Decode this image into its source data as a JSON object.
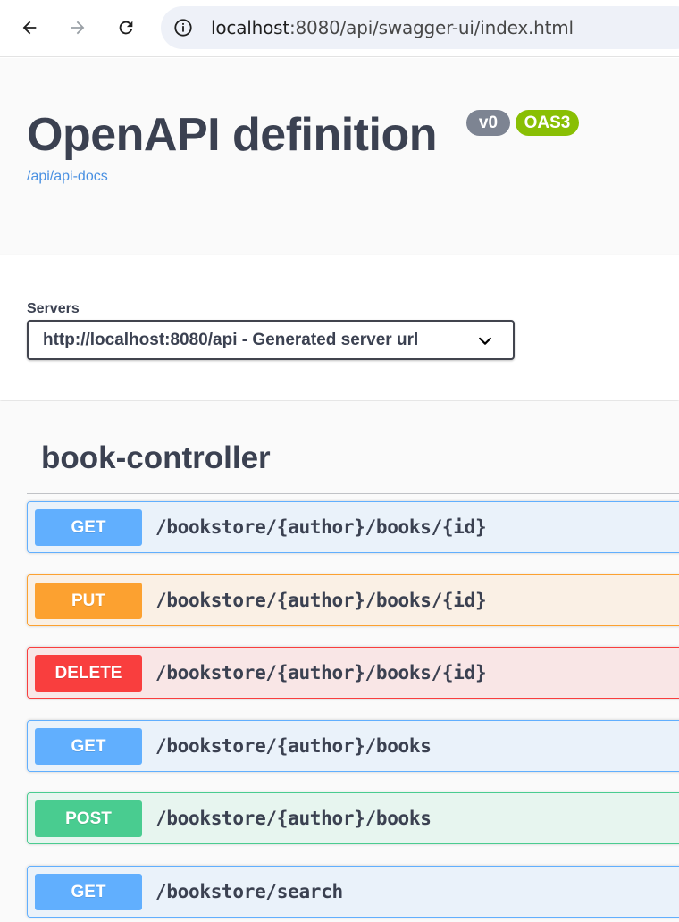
{
  "browser": {
    "url_host": "localhost",
    "url_rest": ":8080/api/swagger-ui/index.html",
    "icons": [
      "back-arrow-icon",
      "forward-arrow-icon",
      "reload-icon",
      "info-icon"
    ]
  },
  "info": {
    "title": "OpenAPI definition",
    "version_badge": "v0",
    "oas_badge": "OAS3",
    "docs_link": "/api/api-docs"
  },
  "servers": {
    "label": "Servers",
    "selected": "http://localhost:8080/api - Generated server url"
  },
  "tag": {
    "name": "book-controller"
  },
  "operations": [
    {
      "method": "GET",
      "path": "/bookstore/{author}/books/{id}"
    },
    {
      "method": "PUT",
      "path": "/bookstore/{author}/books/{id}"
    },
    {
      "method": "DELETE",
      "path": "/bookstore/{author}/books/{id}"
    },
    {
      "method": "GET",
      "path": "/bookstore/{author}/books"
    },
    {
      "method": "POST",
      "path": "/bookstore/{author}/books"
    },
    {
      "method": "GET",
      "path": "/bookstore/search"
    }
  ],
  "colors": {
    "get": "#61affe",
    "put": "#fca130",
    "delete": "#f93e3e",
    "post": "#49cc90",
    "oas_badge": "#89bf04",
    "version_badge": "#7d8492",
    "link": "#4990e2"
  }
}
